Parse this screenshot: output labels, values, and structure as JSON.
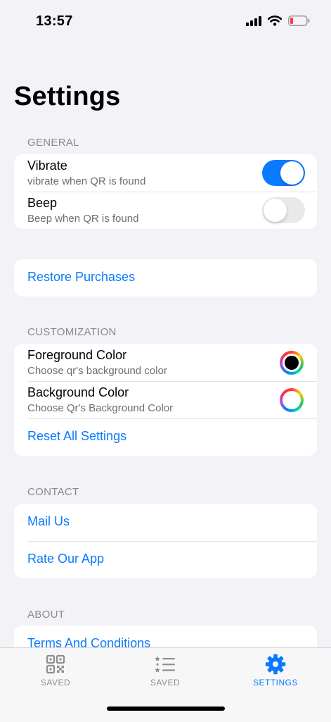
{
  "status": {
    "time": "13:57"
  },
  "title": "Settings",
  "general": {
    "header": "GENERAL",
    "vibrate": {
      "title": "Vibrate",
      "subtitle": "vibrate when QR is found",
      "on": true
    },
    "beep": {
      "title": "Beep",
      "subtitle": "Beep when QR is found",
      "on": false
    }
  },
  "purchases": {
    "restore": "Restore Purchases"
  },
  "customization": {
    "header": "CUSTOMIZATION",
    "foreground": {
      "title": "Foreground Color",
      "subtitle": "Choose qr's background color",
      "color": "#000000"
    },
    "background": {
      "title": "Background Color",
      "subtitle": "Choose Qr's Background Color",
      "color": "#ffffff"
    },
    "reset": "Reset All Settings"
  },
  "contact": {
    "header": "CONTACT",
    "mail": "Mail Us",
    "rate": "Rate Our App"
  },
  "about": {
    "header": "ABOUT",
    "terms": "Terms And Conditions"
  },
  "tabs": [
    {
      "label": "SAVED",
      "icon": "qr-code-icon",
      "active": false
    },
    {
      "label": "SAVED",
      "icon": "list-icon",
      "active": false
    },
    {
      "label": "SETTINGS",
      "icon": "gear-icon",
      "active": true
    }
  ],
  "colors": {
    "accent": "#0a7aff",
    "background": "#f2f2f7",
    "toggle_off": "#e9e9ea",
    "battery_low": "#ff3b30"
  }
}
